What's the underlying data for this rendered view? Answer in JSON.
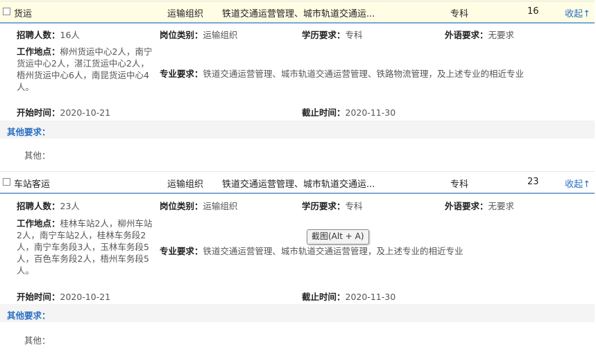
{
  "jobs": [
    {
      "name": "货运",
      "category": "运输组织",
      "major_short": "铁道交通运营管理、城市轨道交通运...",
      "education": "专科",
      "count": "16",
      "toggle": "收起↑",
      "recruit_label": "招聘人数：",
      "recruit_value": "16人",
      "type_label": "岗位类别：",
      "type_value": "运输组织",
      "edu_label": "学历要求：",
      "edu_value": "专科",
      "lang_label": "外语要求：",
      "lang_value": "无要求",
      "loc_label": "工作地点：",
      "loc_value": "柳州货运中心2人，南宁货运中心2人，湛江货运中心2人，梧州货运中心6人，南昆货运中心4人。",
      "major_label": "专业要求：",
      "major_value": "铁道交通运营管理、城市轨道交通运营管理、铁路物流管理，及上述专业的相近专业",
      "start_label": "开始时间：",
      "start_value": "2020-10-21",
      "end_label": "截止时间：",
      "end_value": "2020-11-30",
      "other_label": "其他要求：",
      "other_text": "其他："
    },
    {
      "name": "车站客运",
      "category": "运输组织",
      "major_short": "铁道交通运营管理、城市轨道交通运...",
      "education": "专科",
      "count": "23",
      "toggle": "收起↑",
      "recruit_label": "招聘人数：",
      "recruit_value": "23人",
      "type_label": "岗位类别：",
      "type_value": "运输组织",
      "edu_label": "学历要求：",
      "edu_value": "专科",
      "lang_label": "外语要求：",
      "lang_value": "无要求",
      "loc_label": "工作地点：",
      "loc_value": "桂林车站2人，柳州车站2人，南宁车站2人，桂林车务段2人，南宁车务段3人，玉林车务段5人，百色车务段2人，梧州车务段5人。",
      "major_label": "专业要求：",
      "major_value": "铁道交通运营管理、城市轨道交通运营管理，及上述专业的相近专业",
      "start_label": "开始时间：",
      "start_value": "2020-10-21",
      "end_label": "截止时间：",
      "end_value": "2020-11-30",
      "other_label": "其他要求：",
      "other_text": "其他："
    }
  ],
  "tooltip": "截图(Alt + A)"
}
